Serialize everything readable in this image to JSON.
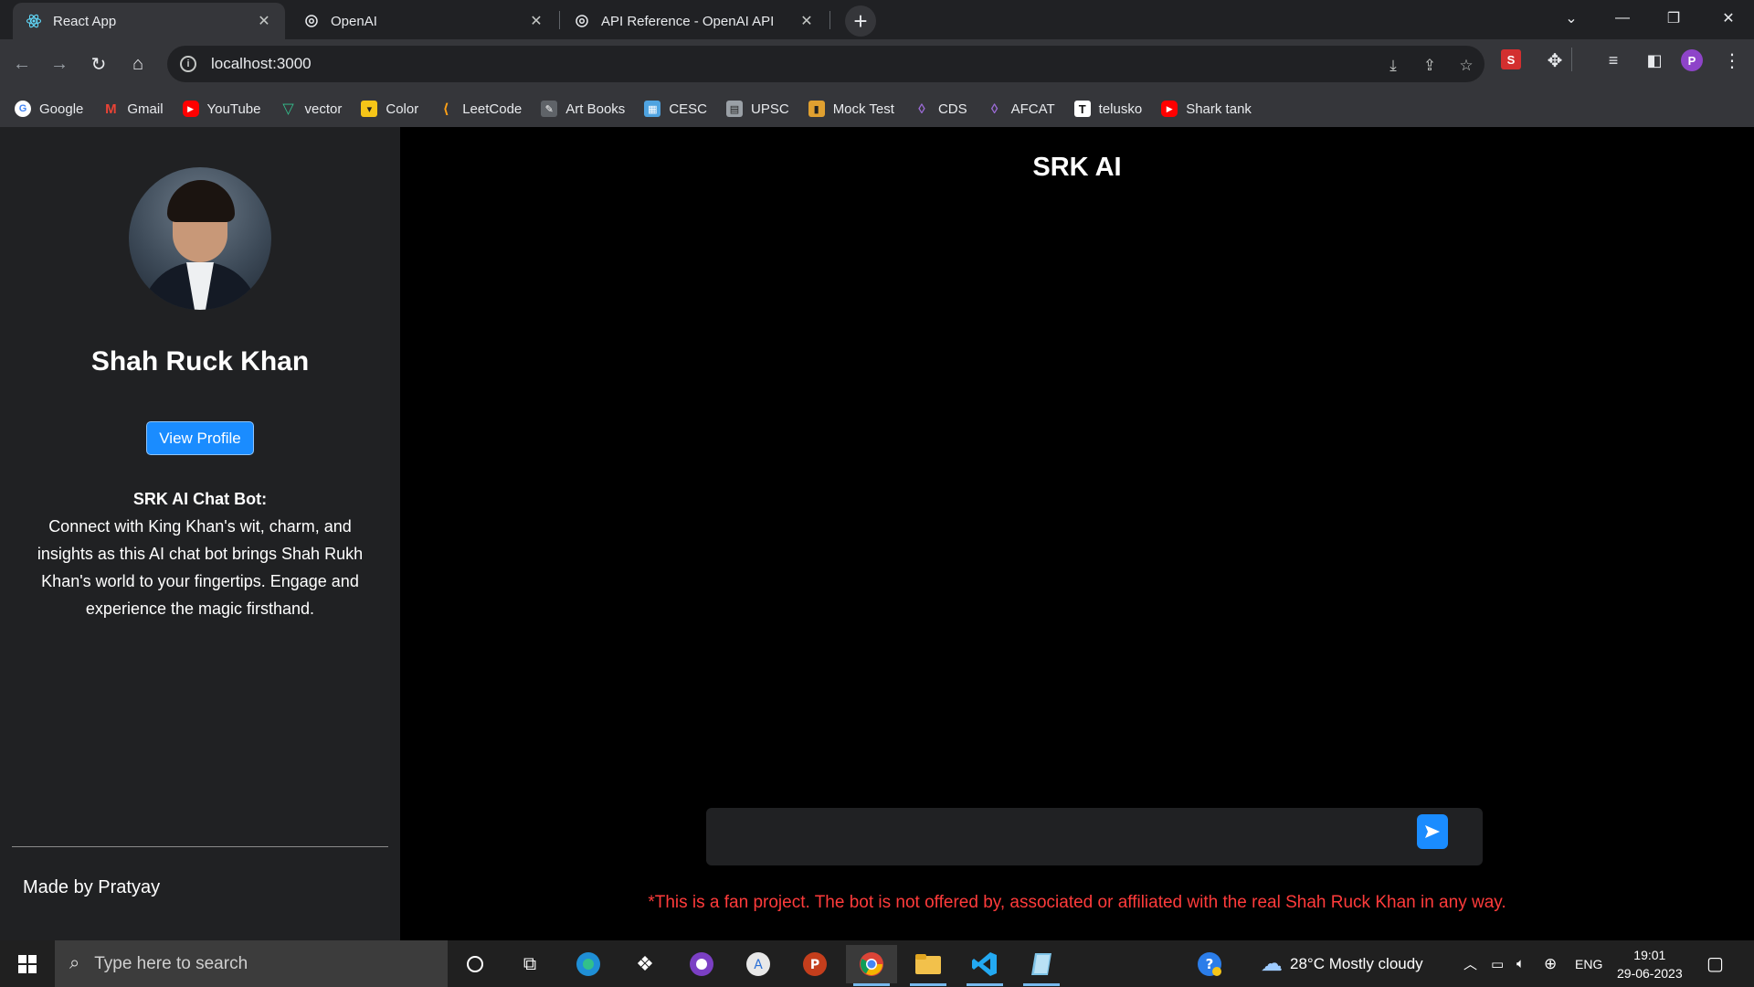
{
  "browser": {
    "tabs": [
      {
        "title": "React App",
        "active": true,
        "icon": "react-icon"
      },
      {
        "title": "OpenAI",
        "active": false,
        "icon": "openai-icon"
      },
      {
        "title": "API Reference - OpenAI API",
        "active": false,
        "icon": "openai-icon"
      }
    ],
    "url": "localhost:3000",
    "profile_initial": "P",
    "extension_initial": "S",
    "bookmarks": [
      {
        "label": "Google",
        "icon": "google-icon",
        "color": "#ffffff"
      },
      {
        "label": "Gmail",
        "icon": "gmail-icon",
        "color": "#ea4335"
      },
      {
        "label": "YouTube",
        "icon": "youtube-icon",
        "color": "#ff0000"
      },
      {
        "label": "vector",
        "icon": "vector-icon",
        "color": "#34c38f"
      },
      {
        "label": "Color",
        "icon": "color-icon",
        "color": "#f5c518"
      },
      {
        "label": "LeetCode",
        "icon": "leetcode-icon",
        "color": "#ffa116"
      },
      {
        "label": "Art Books",
        "icon": "artbooks-icon",
        "color": "#9aa0a6"
      },
      {
        "label": "CESC",
        "icon": "cesc-icon",
        "color": "#4fa3e0"
      },
      {
        "label": "UPSC",
        "icon": "upsc-icon",
        "color": "#9aa0a6"
      },
      {
        "label": "Mock Test",
        "icon": "mocktest-icon",
        "color": "#e0a030"
      },
      {
        "label": "CDS",
        "icon": "cds-icon",
        "color": "#9b6bd6"
      },
      {
        "label": "AFCAT",
        "icon": "afcat-icon",
        "color": "#9b6bd6"
      },
      {
        "label": "telusko",
        "icon": "telusko-icon",
        "color": "#ffffff"
      },
      {
        "label": "Shark tank",
        "icon": "youtube-icon",
        "color": "#ff0000"
      }
    ]
  },
  "sidebar": {
    "name": "Shah Ruck Khan",
    "view_profile_label": "View Profile",
    "bot_heading": "SRK AI Chat Bot:",
    "bot_description": "Connect with King Khan's wit, charm, and insights as this AI chat bot brings Shah Rukh Khan's world to your fingertips. Engage and experience the magic firsthand.",
    "footer": "Made by Pratyay"
  },
  "main": {
    "title": "SRK AI",
    "input_value": "",
    "input_placeholder": "",
    "disclaimer": "*This is a fan project. The bot is not offered by, associated or affiliated with the real Shah Ruck Khan in any way."
  },
  "taskbar": {
    "search_placeholder": "Type here to search",
    "weather": "28°C  Mostly cloudy",
    "language": "ENG",
    "time": "19:01",
    "date": "29-06-2023"
  },
  "colors": {
    "accent": "#1a8cff",
    "disclaimer": "#ff3b3b",
    "sidebar_bg": "#202123",
    "main_bg": "#000000"
  }
}
